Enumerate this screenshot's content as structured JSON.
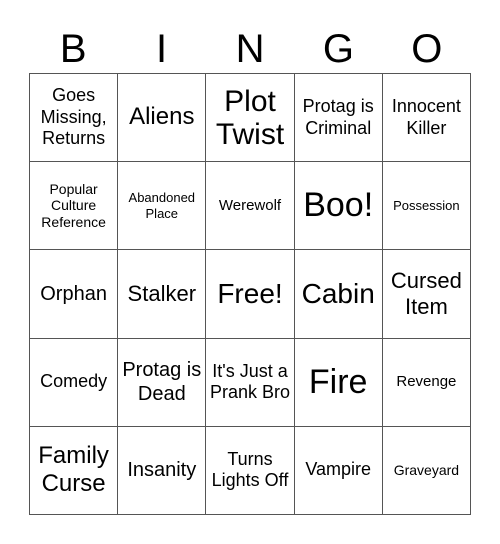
{
  "header": {
    "letters": [
      "B",
      "I",
      "N",
      "G",
      "O"
    ]
  },
  "grid": {
    "rows": [
      [
        "Goes Missing, Returns",
        "Aliens",
        "Plot Twist",
        "Protag is Criminal",
        "Innocent Killer"
      ],
      [
        "Popular Culture Reference",
        "Abandoned Place",
        "Werewolf",
        "Boo!",
        "Possession"
      ],
      [
        "Orphan",
        "Stalker",
        "Free!",
        "Cabin",
        "Cursed Item"
      ],
      [
        "Comedy",
        "Protag is Dead",
        "It's Just a Prank Bro",
        "Fire",
        "Revenge"
      ],
      [
        "Family Curse",
        "Insanity",
        "Turns Lights Off",
        "Vampire",
        "Graveyard"
      ]
    ]
  }
}
